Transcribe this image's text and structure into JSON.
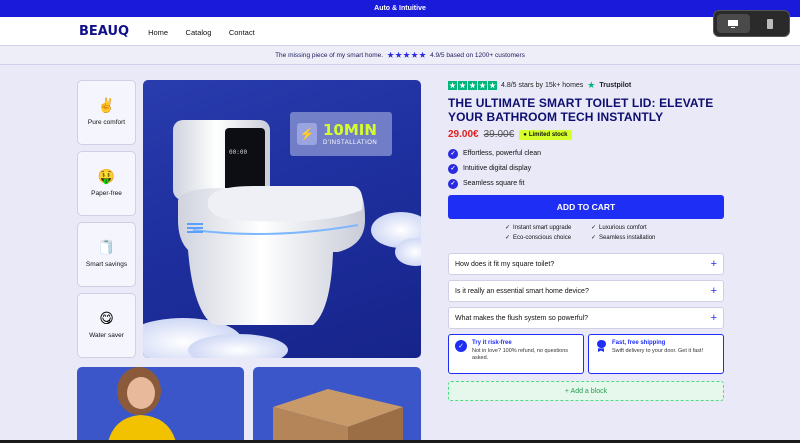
{
  "announcement": "Auto & Intuitive",
  "brand": "BEAUQ",
  "nav": [
    "Home",
    "Catalog",
    "Contact"
  ],
  "trustbar": {
    "text": "The missing piece of my smart home.",
    "rating": "4.9/5 based on 1200+ customers"
  },
  "features": [
    {
      "emoji": "✌️",
      "label": "Pure comfort"
    },
    {
      "emoji": "🤑",
      "label": "Paper-free"
    },
    {
      "emoji": "🧻",
      "label": "Smart savings"
    },
    {
      "emoji": "😋",
      "label": "Water saver"
    }
  ],
  "hero": {
    "badge_big": "10MIN",
    "badge_small": "D'INSTALLATION",
    "display": "00:00"
  },
  "product": {
    "rating_text": "4.8/5 stars by 15k+ homes",
    "trustpilot": "Trustpilot",
    "title": "THE ULTIMATE SMART TOILET LID: ELEVATE YOUR BATHROOM TECH INSTANTLY",
    "price": "29.00€",
    "old_price": "39.00€",
    "stock_badge": "Limited stock",
    "bullets": [
      "Effortless, powerful clean",
      "Intuitive digital display",
      "Seamless square fit"
    ],
    "cta": "ADD TO CART",
    "perks": [
      "Instant smart upgrade",
      "Luxurious comfort",
      "Eco-conscious choice",
      "Seamless installation"
    ],
    "faqs": [
      "How does it fit my square toilet?",
      "Is it really an essential smart home device?",
      "What makes the flush system so powerful?"
    ],
    "info": [
      {
        "title": "Try it risk-free",
        "desc": "Not in love? 100% refund, no questions asked."
      },
      {
        "title": "Fast, free shipping",
        "desc": "Swift delivery to your door. Get it fast!"
      }
    ],
    "add_block": "+ Add a block"
  },
  "colors": {
    "brand_blue": "#1f2ef5",
    "announce": "#1a1adb",
    "price_red": "#e02020",
    "lime": "#d6ff2a",
    "trustpilot_green": "#00b67a"
  }
}
